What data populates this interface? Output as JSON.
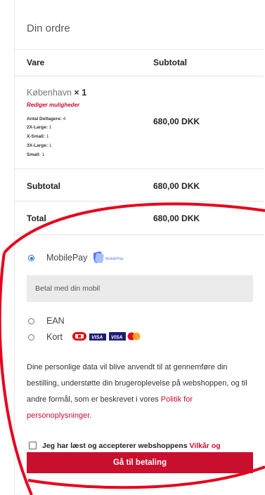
{
  "order": {
    "heading": "Din ordre",
    "col_product": "Vare",
    "col_subtotal": "Subtotal",
    "item": {
      "name": "København",
      "qty": "× 1",
      "edit_label": "Rediger muligheder",
      "meta": [
        {
          "key": "Antal Deltagere:",
          "value": "4"
        },
        {
          "key": "2X-Large:",
          "value": "1"
        },
        {
          "key": "X-Small:",
          "value": "1"
        },
        {
          "key": "3X-Large:",
          "value": "1"
        },
        {
          "key": "Small:",
          "value": "1"
        }
      ],
      "price": "680,00 DKK"
    },
    "subtotal_label": "Subtotal",
    "subtotal_value": "680,00 DKK",
    "total_label": "Total",
    "total_value": "680,00 DKK"
  },
  "payment": {
    "mobilepay": {
      "label": "MobilePay",
      "logo_text": "MobilePay",
      "description": "Betal med din mobil",
      "selected": true
    },
    "ean": {
      "label": "EAN"
    },
    "kort": {
      "label": "Kort",
      "card_texts": [
        "VISA",
        "VISA"
      ]
    }
  },
  "privacy": {
    "text": "Dine personlige data vil blive anvendt til at gennemføre din bestilling, understøtte din brugeroplevelse på webshoppen, og til andre formål, som er beskrevet i vores ",
    "link": "Politik for personoplysninger",
    "end": "."
  },
  "terms": {
    "text": "Jeg har læst og accepterer webshoppens ",
    "link": "Vilkår og betingelser",
    "required": "*"
  },
  "submit_label": "Gå til betaling",
  "colors": {
    "accent": "#c8102e",
    "annotation": "#e8001c",
    "radio": "#1a73e8"
  }
}
